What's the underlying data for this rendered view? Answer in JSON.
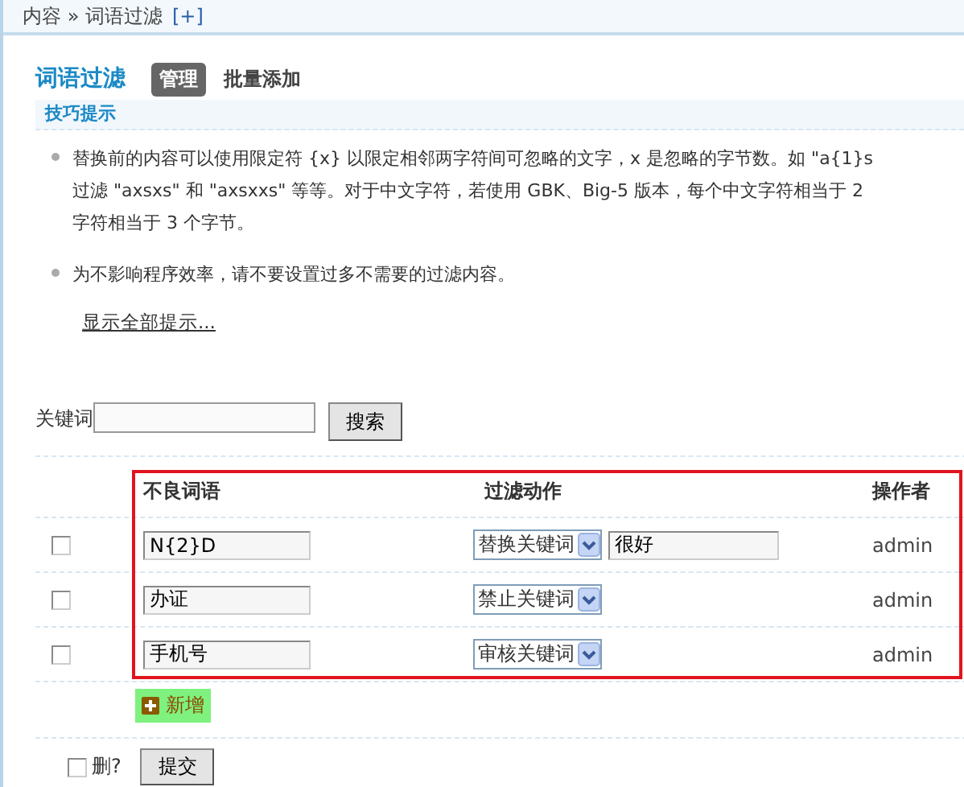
{
  "breadcrumb": {
    "path": "内容 » 词语过滤",
    "add_link": "[+]"
  },
  "page_title": "词语过滤",
  "tabs": [
    {
      "label": "管理",
      "selected": true
    },
    {
      "label": "批量添加",
      "selected": false
    }
  ],
  "tips": {
    "title": "技巧提示",
    "items": [
      {
        "lines": [
          "替换前的内容可以使用限定符 {x} 以限定相邻两字符间可忽略的文字，x 是忽略的字节数。如 \"a{1}s",
          "过滤 \"axsxs\" 和 \"axsxxs\" 等等。对于中文字符，若使用 GBK、Big-5 版本，每个中文字符相当于 2",
          "字符相当于 3 个字节。"
        ]
      },
      {
        "lines": [
          "为不影响程序效率，请不要设置过多不需要的过滤内容。"
        ]
      }
    ],
    "show_all_link": "显示全部提示..."
  },
  "search": {
    "label": "关键词",
    "button": "搜索"
  },
  "table": {
    "columns": [
      "不良词语",
      "过滤动作",
      "操作者"
    ],
    "rows": [
      {
        "checked": false,
        "word": "N{2}D",
        "action": "替换关键词",
        "replacement": "很好",
        "operator": "admin"
      },
      {
        "checked": false,
        "word": "办证",
        "action": "禁止关键词",
        "operator": "admin"
      },
      {
        "checked": false,
        "word": "手机号",
        "action": "审核关键词",
        "operator": "admin"
      }
    ]
  },
  "add_button": "新增",
  "delete_option": {
    "label": "删?",
    "checked": false
  },
  "submit_button": "提交"
}
